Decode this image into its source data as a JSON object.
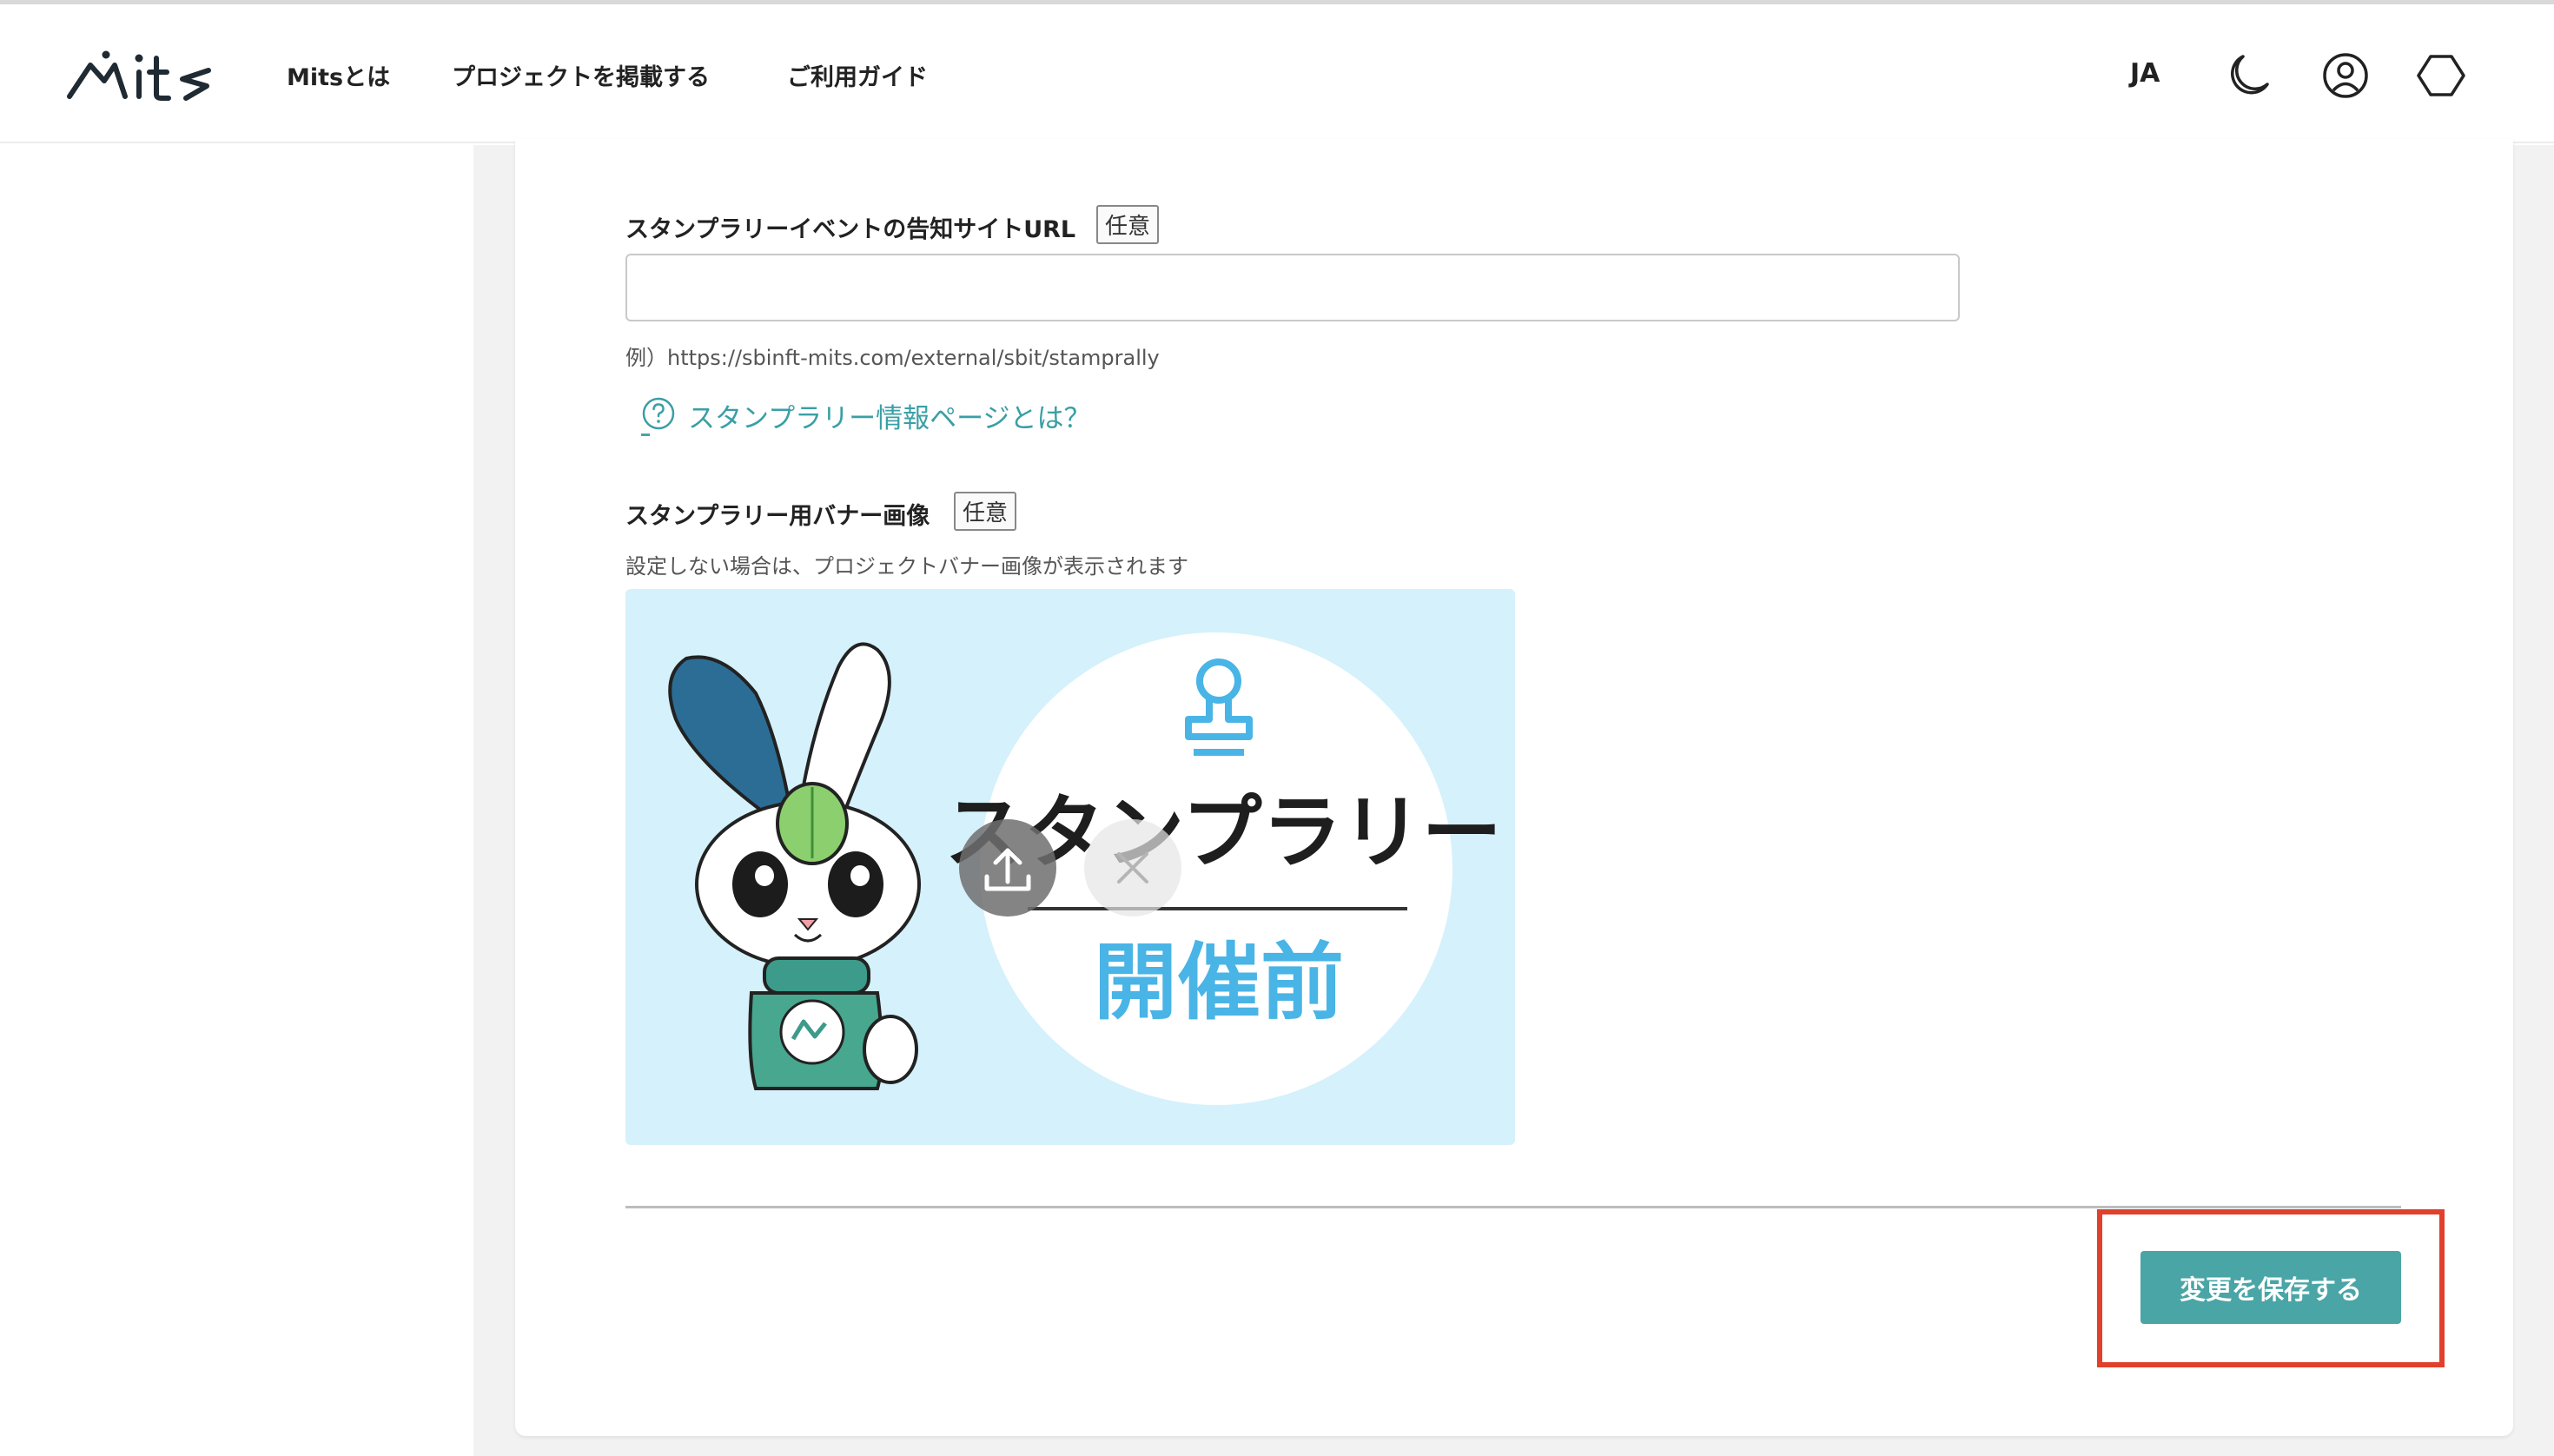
{
  "header": {
    "logo_text": "mits",
    "nav": [
      "Mitsとは",
      "プロジェクトを掲載する",
      "ご利用ガイド"
    ],
    "language": "JA",
    "icons": [
      "moon-icon",
      "account-circle-icon",
      "wallet-hexagon-icon"
    ]
  },
  "form": {
    "url_field": {
      "label": "スタンプラリーイベントの告知サイトURL",
      "badge": "任意",
      "value": "",
      "placeholder": "",
      "example": "例）https://sbinft-mits.com/external/sbit/stamprally"
    },
    "help_link": {
      "label": "スタンプラリー情報ページとは？",
      "icon": "question-circle-icon"
    },
    "banner_field": {
      "label": "スタンプラリー用バナー画像",
      "badge": "任意",
      "description": "設定しない場合は、プロジェクトバナー画像が表示されます",
      "image": {
        "title": "スタンプラリー",
        "subtitle": "開催前",
        "icons": [
          "stamp-icon",
          "rabbit-mascot"
        ]
      },
      "actions": [
        "upload-icon",
        "close-icon"
      ]
    },
    "save_label": "変更を保存する"
  },
  "colors": {
    "accent": "#4aa5a6",
    "link": "#3a9fa5",
    "banner_bg": "#d5f1fb",
    "highlight": "#e0402c",
    "banner_text_blue": "#49b4e6"
  }
}
